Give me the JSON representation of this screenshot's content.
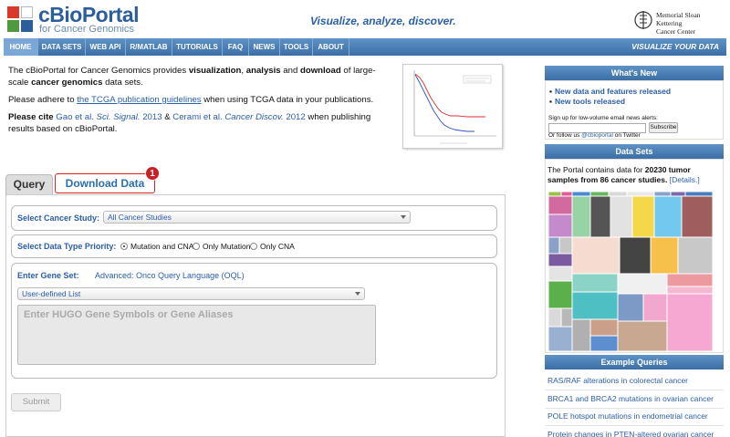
{
  "header": {
    "logo_title": "cBioPortal",
    "logo_subtitle": "for Cancer Genomics",
    "tagline": "Visualize, analyze, discover.",
    "partner_line1": "Memorial Sloan Kettering",
    "partner_line2": "Cancer Center"
  },
  "nav": {
    "items": [
      "HOME",
      "DATA SETS",
      "WEB API",
      "R/MATLAB",
      "TUTORIALS",
      "FAQ",
      "NEWS",
      "TOOLS",
      "ABOUT"
    ],
    "right_label": "VISUALIZE YOUR DATA"
  },
  "intro": {
    "p1_a": "The cBioPortal for Cancer Genomics provides ",
    "p1_b": "visualization",
    "p1_c": ", ",
    "p1_d": "analysis",
    "p1_e": " and ",
    "p1_f": "download",
    "p1_g": " of large-scale ",
    "p1_h": "cancer genomics",
    "p1_i": " data sets.",
    "p2_a": "Please adhere to ",
    "p2_link": "the TCGA publication guidelines",
    "p2_b": " when using TCGA data in your publications.",
    "p3_cite": "Please cite",
    "p3_ref1": "Gao et al. ",
    "p3_ref1_journal": "Sci. Signal.",
    "p3_ref1_year": " 2013",
    "p3_and": " & ",
    "p3_ref2": "Cerami et al. ",
    "p3_ref2_journal": "Cancer Discov.",
    "p3_ref2_year": " 2012",
    "p3_tail": " when publishing results based on cBioPortal."
  },
  "tabs": {
    "query": "Query",
    "download": "Download Data",
    "badge": "1"
  },
  "form": {
    "study_label": "Select Cancer Study:",
    "study_value": "All Cancer Studies",
    "priority_label": "Select Data Type Priority:",
    "priority_options": [
      "Mutation and CNA",
      "Only Mutation",
      "Only CNA"
    ],
    "gene_label": "Enter Gene Set:",
    "gene_link": "Advanced: Onco Query Language (OQL)",
    "gene_list_value": "User-defined List",
    "gene_placeholder": "Enter HUGO Gene Symbols or Gene Aliases",
    "submit": "Submit"
  },
  "sidebar": {
    "whats_new_title": "What's New",
    "news": [
      "New data and features released",
      "New tools released"
    ],
    "signup_text": "Sign up for low-volume email news alerts:",
    "subscribe": "Subscribe",
    "twitter_a": "Or follow us ",
    "twitter_handle": "@cbioportal",
    "twitter_b": " on Twitter",
    "datasets_title": "Data Sets",
    "datasets_a": "The Portal contains data for ",
    "datasets_b": "20230 tumor samples from 86 cancer studies.",
    "datasets_link": "[Details.]",
    "examples_title": "Example Queries",
    "examples": [
      "RAS/RAF alterations in colorectal cancer",
      "BRCA1 and BRCA2 mutations in ovarian cancer",
      "POLE hotspot mutations in endometrial cancer",
      "Protein changes in PTEN-altered ovarian cancer"
    ]
  },
  "colors": {
    "brand": "#2b5e9a",
    "nav": "#3b6ea5",
    "link": "#2a5ea8",
    "badge": "#c81e24"
  }
}
